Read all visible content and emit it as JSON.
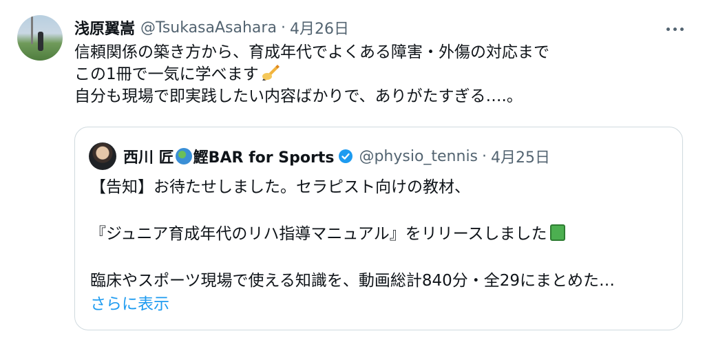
{
  "tweet": {
    "author_name": "浅原翼嵩",
    "author_handle": "@TsukasaAsahara",
    "separator": "·",
    "date": "4月26日",
    "more_icon": "more-horizontal-icon",
    "lines": [
      "信頼関係の築き方から、育成年代でよくある障害・外傷の対応まで",
      "この1冊で一気に学べます",
      "自分も現場で即実践したい内容ばかりで、ありがたすぎる….。"
    ],
    "emoji_after_line2": "writing-hand-icon"
  },
  "quote": {
    "author_name_part1": "西川 匠",
    "globe_icon": "globe-asia-icon",
    "author_name_part2": "鰹BAR for Sports",
    "verified_icon": "verified-badge-icon",
    "verified_color": "#1d9bf0",
    "author_handle": "@physio_tennis",
    "separator": "·",
    "date": "4月25日",
    "lines": [
      "【告知】お待たせしました。セラピスト向けの教材、",
      "『ジュニア育成年代のリハ指導マニュアル』をリリースしました",
      "臨床やスポーツ現場で使える知識を、動画総計840分・全29にまとめた…"
    ],
    "emoji_after_line2": "green-book-icon",
    "show_more": "さらに表示",
    "link_color": "#1d9bf0"
  }
}
